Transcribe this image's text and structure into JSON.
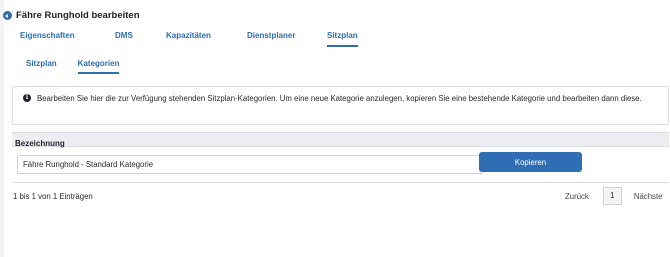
{
  "header": {
    "title": "Fähre Runghold bearbeiten"
  },
  "tabs": [
    {
      "label": "Eigenschaften",
      "active": false
    },
    {
      "label": "DMS",
      "active": false
    },
    {
      "label": "Kapazitäten",
      "active": false
    },
    {
      "label": "Dienstplaner",
      "active": false
    },
    {
      "label": "Sitzplan",
      "active": true
    }
  ],
  "subtabs": [
    {
      "label": "Sitzplan",
      "active": false
    },
    {
      "label": "Kategorien",
      "active": true
    }
  ],
  "info": {
    "text": "Bearbeiten Sie hier die zur Verfügung stehenden Sitzplan-Kategorien. Um eine neue Kategorie anzulegen, kopieren Sie eine bestehende Kategorie und bearbeiten dann diese."
  },
  "table": {
    "column_header": "Bezeichnung",
    "rows": [
      {
        "name": "Fähre Runghold - Standard Kategorie",
        "action_label": "Kopieren"
      }
    ]
  },
  "footer": {
    "entries_text": "1 bis 1 von 1 Einträgen",
    "prev_label": "Zurück",
    "current_page": "1",
    "next_label": "Nächste"
  },
  "colors": {
    "accent": "#2f6db5",
    "header_bg": "#eceef1",
    "border": "#d9dde3"
  }
}
